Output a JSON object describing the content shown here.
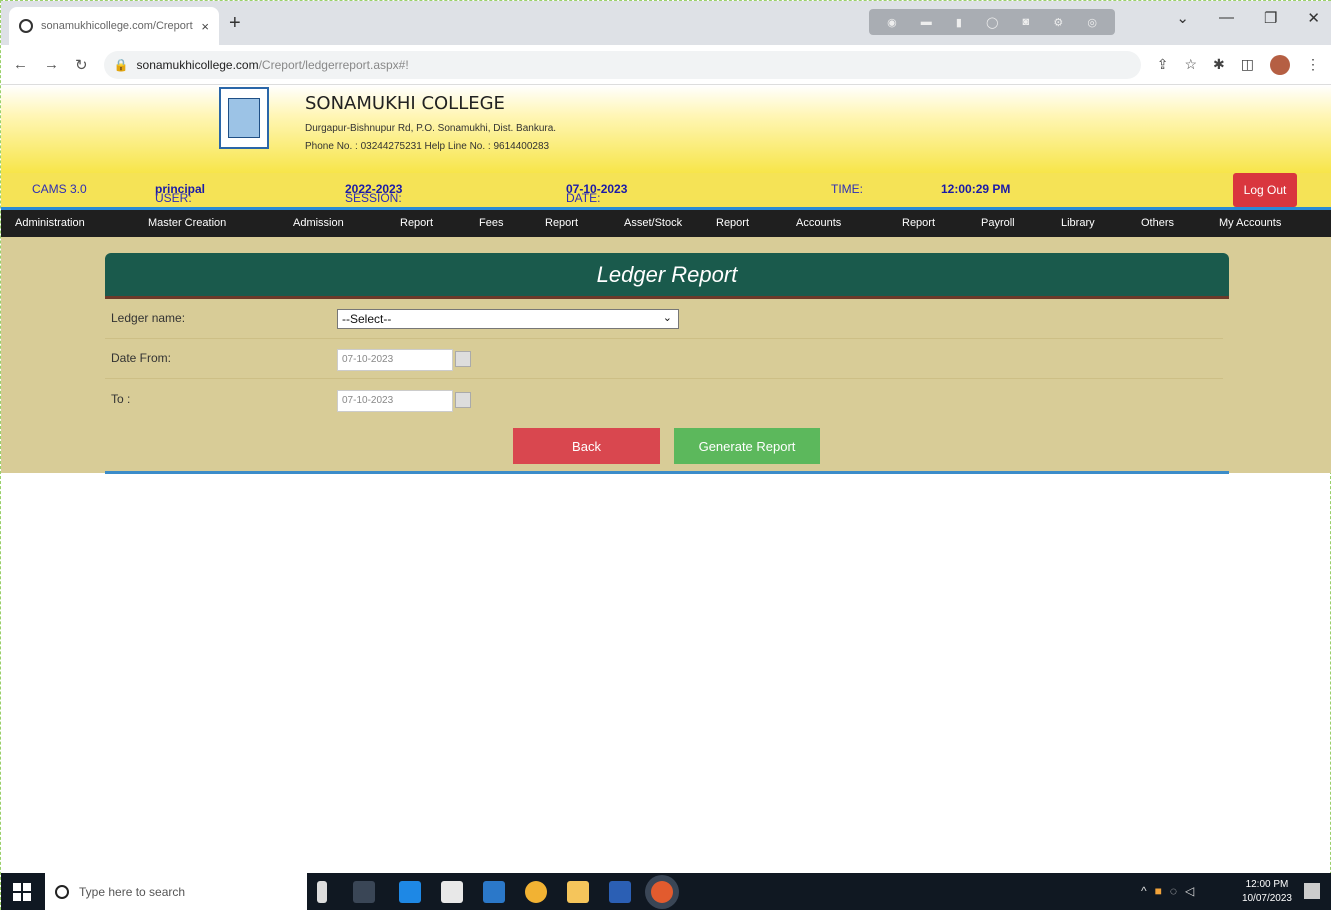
{
  "browser": {
    "tab_title": "sonamukhicollege.com/Creport",
    "tab_close": "×",
    "new_tab": "+",
    "address_host": "sonamukhicollege.com",
    "address_path": "/Creport/ledgerreport.aspx#!",
    "window_controls": [
      "⌄",
      "—",
      "❐",
      "✕"
    ]
  },
  "college": {
    "name": "SONAMUKHI COLLEGE",
    "address": "Durgapur-Bishnupur Rd, P.O. Sonamukhi, Dist. Bankura.",
    "phone": "Phone No. : 03244275231  Help Line No. : 9614400283"
  },
  "infobar": {
    "system": "CAMS 3.0",
    "user_label": "USER:",
    "user_value": "principal",
    "session_label": "SESSION:",
    "session_value": "2022-2023",
    "date_label": "DATE:",
    "date_value": "07-10-2023",
    "time_label": "TIME:",
    "time_value": "12:00:29 PM",
    "logout": "Log Out"
  },
  "nav": {
    "items": [
      "Administration",
      "Master Creation",
      "Admission",
      "Report",
      "Fees",
      "Report",
      "Asset/Stock",
      "Report",
      "Accounts",
      "Report",
      "Payroll",
      "Library",
      "Others",
      "My Accounts"
    ]
  },
  "form": {
    "title": "Ledger Report",
    "ledger_label": "Ledger name:",
    "ledger_value": "--Select--",
    "date_from_label": "Date From:",
    "date_from_value": "07-10-2023",
    "to_label": "To :",
    "to_value": "07-10-2023",
    "back_button": "Back",
    "generate_button": "Generate Report"
  },
  "taskbar": {
    "search_placeholder": "Type here to search",
    "time": "12:00 PM",
    "date": "10/07/2023"
  }
}
